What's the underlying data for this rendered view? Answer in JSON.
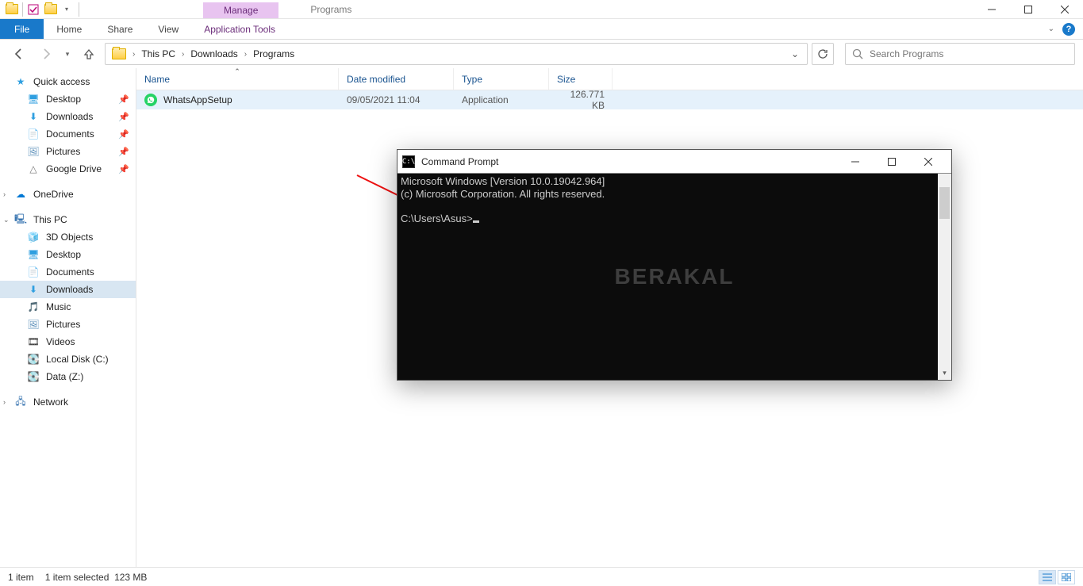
{
  "titlebar": {
    "context_tab": "Manage",
    "window_title": "Programs"
  },
  "ribbon": {
    "file": "File",
    "tabs": [
      "Home",
      "Share",
      "View"
    ],
    "context_tab": "Application Tools"
  },
  "breadcrumb": {
    "items": [
      "This PC",
      "Downloads",
      "Programs"
    ]
  },
  "search": {
    "placeholder": "Search Programs"
  },
  "sidebar": {
    "quick_access": {
      "label": "Quick access",
      "items": [
        {
          "label": "Desktop",
          "pinned": true
        },
        {
          "label": "Downloads",
          "pinned": true
        },
        {
          "label": "Documents",
          "pinned": true
        },
        {
          "label": "Pictures",
          "pinned": true
        },
        {
          "label": "Google Drive",
          "pinned": true
        }
      ]
    },
    "onedrive": {
      "label": "OneDrive"
    },
    "this_pc": {
      "label": "This PC",
      "items": [
        {
          "label": "3D Objects"
        },
        {
          "label": "Desktop"
        },
        {
          "label": "Documents"
        },
        {
          "label": "Downloads",
          "active": true
        },
        {
          "label": "Music"
        },
        {
          "label": "Pictures"
        },
        {
          "label": "Videos"
        },
        {
          "label": "Local Disk (C:)"
        },
        {
          "label": "Data (Z:)"
        }
      ]
    },
    "network": {
      "label": "Network"
    }
  },
  "columns": {
    "name": "Name",
    "date": "Date modified",
    "type": "Type",
    "size": "Size"
  },
  "files": [
    {
      "name": "WhatsAppSetup",
      "date": "09/05/2021 11:04",
      "type": "Application",
      "size": "126.771 KB"
    }
  ],
  "statusbar": {
    "count": "1 item",
    "selection": "1 item selected",
    "sel_size": "123 MB"
  },
  "cmd": {
    "title": "Command Prompt",
    "line1": "Microsoft Windows [Version 10.0.19042.964]",
    "line2": "(c) Microsoft Corporation. All rights reserved.",
    "prompt": "C:\\Users\\Asus>",
    "watermark": "BERAKAL"
  }
}
